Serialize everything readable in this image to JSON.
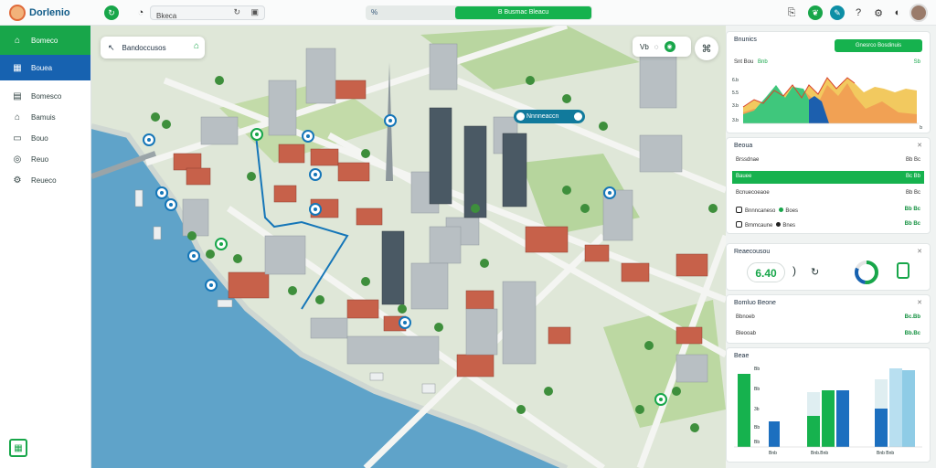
{
  "app": {
    "title": "Dorlenio"
  },
  "topbar": {
    "search_value": "Bkeca",
    "segment_left": "%",
    "segment_right": "B Busmac Bleacu"
  },
  "sidebar": {
    "items": [
      {
        "label": "Bomeco",
        "icon": "home-icon"
      },
      {
        "label": "Bouea",
        "icon": "city-icon"
      },
      {
        "label": "Bomesco",
        "icon": "building-icon"
      },
      {
        "label": "Bamuis",
        "icon": "house-icon"
      },
      {
        "label": "Bouo",
        "icon": "layers-icon"
      },
      {
        "label": "Reuo",
        "icon": "location-icon"
      },
      {
        "label": "Reueco",
        "icon": "settings-icon"
      }
    ]
  },
  "map": {
    "title": "Bandoccusos",
    "controls_label": "Vb",
    "pill_label": "Nnnneaccn"
  },
  "panel": {
    "card1": {
      "title": "Bnunics",
      "button": "Gnesrco Bosdinuis",
      "legend_left": "Snt Bou",
      "legend_green": "Bnb",
      "legend_right": "Sb",
      "y_ticks": [
        "6.b",
        "5.5",
        "3.b",
        "3.b"
      ],
      "x_end": "b"
    },
    "card2": {
      "title": "Beoua",
      "rows": [
        {
          "label": "Brssdnae",
          "value": "Bb Bc"
        },
        {
          "label": "Bauee",
          "value": "Bc Bb"
        },
        {
          "label": "Bcnuecoeaoe",
          "value": "Bb Bc"
        },
        {
          "label": "Bnnncaneso",
          "value": "Bb Bc",
          "extra": "Boes"
        },
        {
          "label": "Bmmcaune",
          "value": "Bb Bc",
          "extra": "Bnes"
        }
      ]
    },
    "card3": {
      "title": "Reaecousou",
      "big_value": "6.40",
      "symbol": ")"
    },
    "card4": {
      "title": "Bomluo Beone",
      "rows": [
        {
          "label": "Bbnoeb",
          "value": "Bc.Bb"
        },
        {
          "label": "Bleooab",
          "value": "Bb.Bc"
        }
      ]
    },
    "card5": {
      "title": "Beae",
      "y_ticks": [
        "Bb",
        "Bb",
        "3b",
        "Bb",
        "Bb"
      ],
      "x_labels": [
        "Bnb",
        "Bnb.Bnb",
        "Bnb Bnb"
      ]
    }
  },
  "colors": {
    "accent_green": "#18a64a",
    "accent_blue": "#1762b0",
    "water": "#5fa3c9"
  }
}
